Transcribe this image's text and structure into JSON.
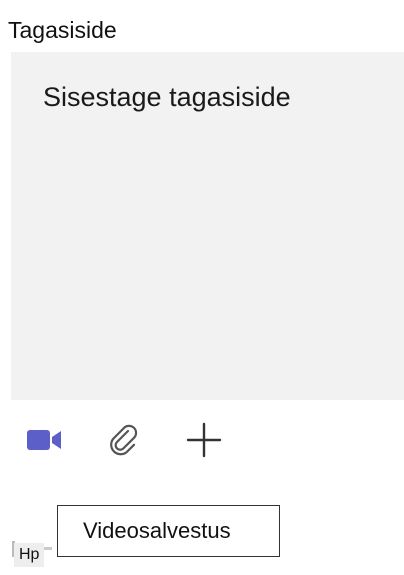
{
  "feedback": {
    "title": "Tagasiside",
    "input_placeholder": "Sisestage tagasiside"
  },
  "toolbar": {
    "items": [
      {
        "icon": "video-camera-icon",
        "color": "#5b5fc7"
      },
      {
        "icon": "paperclip-icon",
        "color": "#555555"
      },
      {
        "icon": "plus-icon",
        "color": "#333333"
      }
    ]
  },
  "tooltip": {
    "text": "Videosalvestus"
  },
  "keyboard_hint": {
    "text": "Hp"
  }
}
